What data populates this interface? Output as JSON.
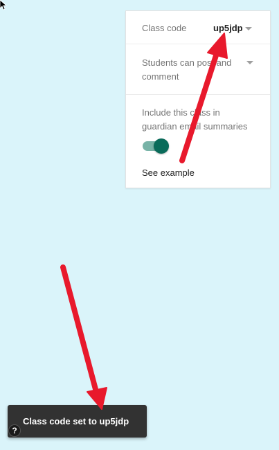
{
  "settings": {
    "class_code_label": "Class code",
    "class_code_value": "up5jdp",
    "students_label": "Students can post and comment",
    "guardian_label": "Include this class in guardian email summaries",
    "guardian_toggle_on": true,
    "see_example": "See example"
  },
  "toast": {
    "message": "Class code set to up5jdp"
  },
  "help": {
    "glyph": "?"
  },
  "annotations": {
    "arrow_color": "#e8192c"
  },
  "colors": {
    "background": "#daf4fa",
    "toggle_knob": "#0a6b5a",
    "toggle_track": "#78b3a7",
    "toast_bg": "#323232"
  },
  "icons": [
    "cursor-icon",
    "dropdown-caret-icon",
    "help-icon"
  ]
}
